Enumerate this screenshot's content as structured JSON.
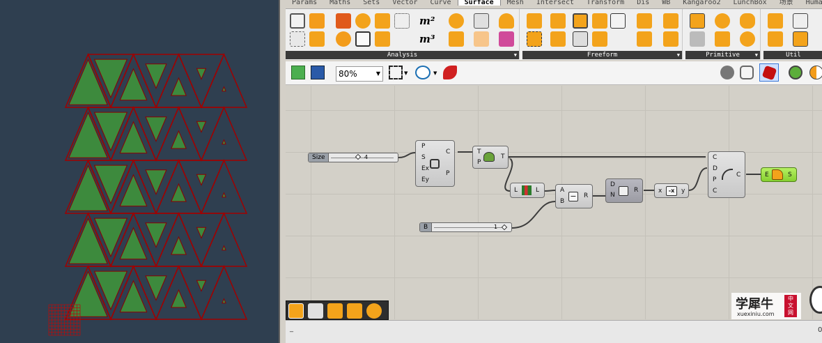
{
  "menu_tabs": [
    "Params",
    "Maths",
    "Sets",
    "Vector",
    "Curve",
    "Surface",
    "Mesh",
    "Intersect",
    "Transform",
    "Dis",
    "WB",
    "Kangaroo2",
    "LunchBox",
    "场景",
    "Human"
  ],
  "ribbon": {
    "panels": [
      {
        "label": "Analysis"
      },
      {
        "label": "Freeform"
      },
      {
        "label": "Primitive"
      },
      {
        "label": "Util"
      }
    ],
    "icon_text_m2": "m²",
    "icon_text_m3": "m³"
  },
  "toolbar": {
    "zoom_value": "80%",
    "zoom_arrow": "▼"
  },
  "canvas": {
    "slider_size": {
      "label": "Size",
      "value": "4"
    },
    "slider_b": {
      "label": "B",
      "value": "1"
    },
    "hexgrid": {
      "inputs": [
        "P",
        "S",
        "Ex",
        "Ey"
      ],
      "outputs": [
        "C",
        "P"
      ]
    },
    "tri": {
      "inputs": [
        "T",
        "P"
      ],
      "outputs": [
        "T"
      ]
    },
    "length": {
      "inputs": [
        "L"
      ],
      "outputs": [
        "L"
      ]
    },
    "subtract": {
      "inputs": [
        "A",
        "B"
      ],
      "outputs": [
        "R"
      ],
      "glyph": "−"
    },
    "division": {
      "inputs": [
        "D",
        "N"
      ],
      "outputs": [
        "R"
      ]
    },
    "negative": {
      "inputs": [
        "x"
      ],
      "outputs": [
        "y"
      ],
      "glyph": "-x"
    },
    "offset": {
      "inputs": [
        "C",
        "D",
        "P",
        "C"
      ],
      "outputs": [
        "C"
      ]
    },
    "extrude": {
      "inputs": [
        "E"
      ],
      "outputs": [
        "S"
      ]
    }
  },
  "watermark": {
    "title": "学犀牛",
    "url": "xuexiniu.com",
    "seal": [
      "中",
      "文",
      "网"
    ]
  },
  "status": {
    "left": "_",
    "right": "0"
  },
  "colors": {
    "triangle_fill": "#3d8a3d",
    "triangle_stroke": "#8b0000",
    "hex_stroke": "#a00000",
    "accent_orange": "#f3a31b",
    "extrude_green": "#a4e04a"
  }
}
